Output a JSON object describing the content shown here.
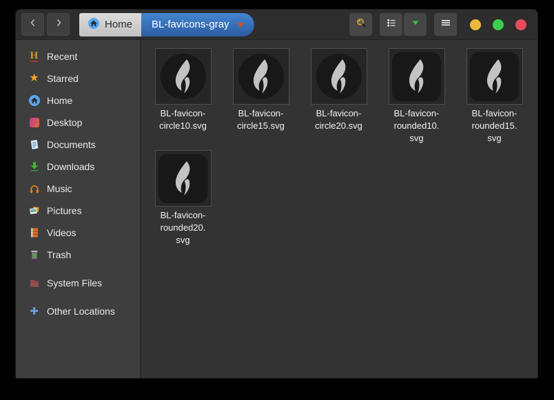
{
  "titlebar": {
    "nav": {
      "back_icon": "chevron-left",
      "forward_icon": "chevron-right"
    },
    "path": {
      "home_label": "Home",
      "current_label": "BL-favicons-gray",
      "caret_icon": "caret-down"
    },
    "tools": {
      "search_icon": "magnifier",
      "list_view_icon": "list-view",
      "view_dropdown_icon": "green-caret-down",
      "menu_icon": "hamburger"
    },
    "window_buttons": {
      "minimize_color": "#edb73a",
      "maximize_color": "#3bd14e",
      "close_color": "#e84c5c"
    }
  },
  "sidebar": {
    "items": [
      {
        "icon": "recent-icon",
        "label": "Recent"
      },
      {
        "icon": "star-icon",
        "label": "Starred"
      },
      {
        "icon": "home-icon",
        "label": "Home"
      },
      {
        "icon": "desktop-icon",
        "label": "Desktop"
      },
      {
        "icon": "documents-icon",
        "label": "Documents"
      },
      {
        "icon": "downloads-icon",
        "label": "Downloads"
      },
      {
        "icon": "music-icon",
        "label": "Music"
      },
      {
        "icon": "pictures-icon",
        "label": "Pictures"
      },
      {
        "icon": "videos-icon",
        "label": "Videos"
      },
      {
        "icon": "trash-icon",
        "label": "Trash"
      },
      {
        "icon": "system-files-icon",
        "label": "System Files"
      },
      {
        "icon": "other-locations-icon",
        "label": "Other Locations"
      }
    ]
  },
  "files": {
    "items": [
      {
        "name": "BL-favicon-\ncircle10.svg",
        "shape": "circle"
      },
      {
        "name": "BL-favicon-\ncircle15.svg",
        "shape": "circle"
      },
      {
        "name": "BL-favicon-\ncircle20.svg",
        "shape": "circle"
      },
      {
        "name": "BL-favicon-\nrounded10.\nsvg",
        "shape": "rounded"
      },
      {
        "name": "BL-favicon-\nrounded15.\nsvg",
        "shape": "rounded"
      },
      {
        "name": "BL-favicon-\nrounded20.\nsvg",
        "shape": "rounded"
      }
    ]
  },
  "colors": {
    "desktop_bg": "#000000",
    "headerbar_bg": "#2d2d2d",
    "sidebar_bg": "#3e3e3e",
    "content_bg": "#333333",
    "breadcrumb_active_top": "#4486d3",
    "breadcrumb_active_bottom": "#2b5c9f",
    "breadcrumb_caret": "#cf4e22",
    "flame": "#c3c3c3",
    "tile_bg": "#262626"
  }
}
